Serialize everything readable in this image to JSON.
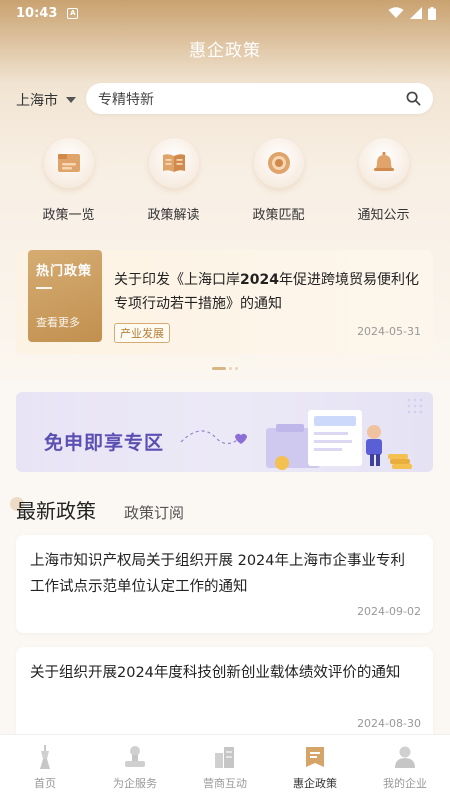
{
  "status_bar": {
    "time": "10:43",
    "notif_icon": "A"
  },
  "header": {
    "title": "惠企政策"
  },
  "location": {
    "city": "上海市"
  },
  "search": {
    "value": "专精特新"
  },
  "quick_links": [
    {
      "label": "政策一览",
      "icon": "policy-list-icon"
    },
    {
      "label": "政策解读",
      "icon": "book-icon"
    },
    {
      "label": "政策匹配",
      "icon": "target-icon"
    },
    {
      "label": "通知公示",
      "icon": "bell-icon"
    }
  ],
  "hot": {
    "tag_title": "热门政策",
    "tag_more": "查看更多",
    "title_pre": "关于印发《上海口岸",
    "title_bold": "2024",
    "title_post": "年促进跨境贸易便利化专项行动若干措施》的通知",
    "badge": "产业发展",
    "date": "2024-05-31"
  },
  "banner": {
    "text": "免申即享专区"
  },
  "tabs": {
    "active": "最新政策",
    "other": "政策订阅"
  },
  "policies": [
    {
      "title": "上海市知识产权局关于组织开展 2024年上海市企事业专利工作试点示范单位认定工作的通知",
      "date": "2024-09-02"
    },
    {
      "title": "关于组织开展2024年度科技创新创业载体绩效评价的通知",
      "date": "2024-08-30"
    }
  ],
  "tabbar": [
    {
      "label": "首页",
      "icon": "home-icon",
      "active": false
    },
    {
      "label": "为企服务",
      "icon": "service-icon",
      "active": false
    },
    {
      "label": "营商互动",
      "icon": "interact-icon",
      "active": false
    },
    {
      "label": "惠企政策",
      "icon": "policy-icon",
      "active": true
    },
    {
      "label": "我的企业",
      "icon": "user-icon",
      "active": false
    }
  ],
  "colors": {
    "accent": "#c9a270",
    "banner_text": "#5b4fb3"
  }
}
